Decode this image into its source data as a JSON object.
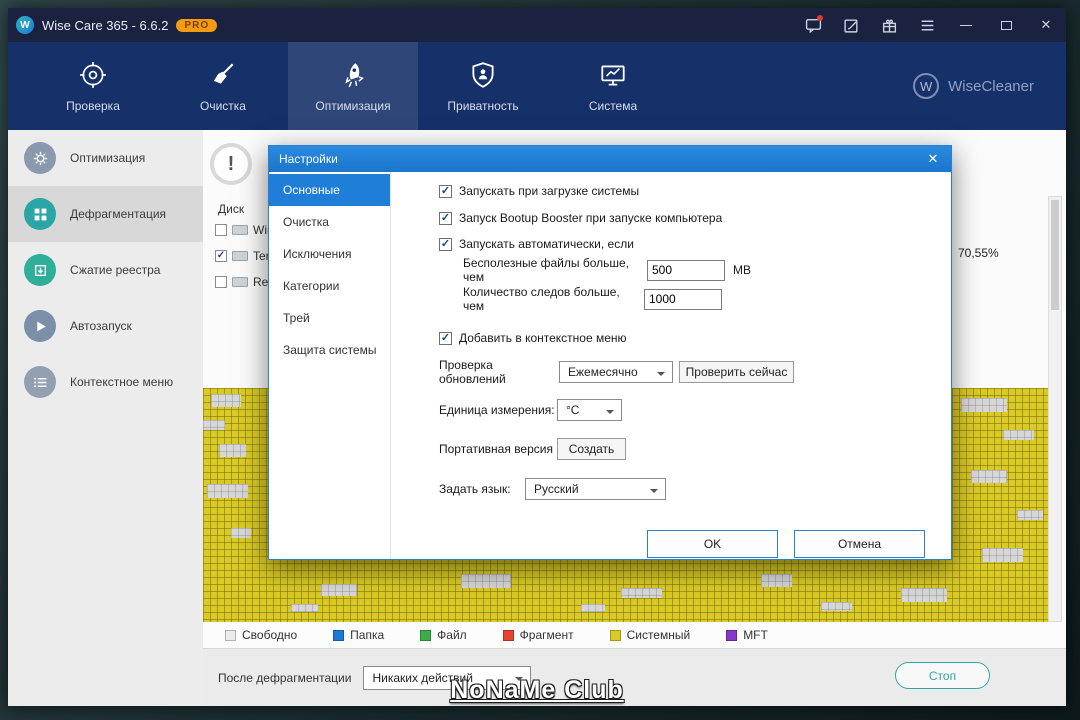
{
  "titlebar": {
    "title": "Wise Care 365 - 6.6.2",
    "pro": "PRO"
  },
  "nav": {
    "items": [
      {
        "label": "Проверка"
      },
      {
        "label": "Очистка"
      },
      {
        "label": "Оптимизация"
      },
      {
        "label": "Приватность"
      },
      {
        "label": "Система"
      }
    ],
    "brand": "WiseCleaner",
    "brand_initial": "W"
  },
  "sidebar": {
    "items": [
      {
        "label": "Оптимизация"
      },
      {
        "label": "Дефрагментация"
      },
      {
        "label": "Сжатие реестра"
      },
      {
        "label": "Автозапуск"
      },
      {
        "label": "Контекстное меню"
      }
    ]
  },
  "defrag": {
    "alert_glyph": "!",
    "disk_header": "Диск",
    "disks": [
      {
        "label": "Window",
        "checked": false
      },
      {
        "label": "Termina",
        "checked": true
      },
      {
        "label": "Replace",
        "checked": false
      }
    ],
    "usage_percent": "70,55%",
    "legend": [
      {
        "label": "Свободно",
        "color": "#ececec"
      },
      {
        "label": "Папка",
        "color": "#1d79d4"
      },
      {
        "label": "Файл",
        "color": "#3cae47"
      },
      {
        "label": "Фрагмент",
        "color": "#e54430"
      },
      {
        "label": "Системный",
        "color": "#d9ca25"
      },
      {
        "label": "MFT",
        "color": "#8636c9"
      }
    ],
    "after_label": "После дефрагментации",
    "after_value": "Никаких действий",
    "stop": "Стоп"
  },
  "settings": {
    "title": "Настройки",
    "close_glyph": "✕",
    "tabs": [
      {
        "label": "Основные"
      },
      {
        "label": "Очистка"
      },
      {
        "label": "Исключения"
      },
      {
        "label": "Категории"
      },
      {
        "label": "Трей"
      },
      {
        "label": "Защита системы"
      }
    ],
    "options": {
      "run_at_boot": "Запускать при загрузке системы",
      "bootup_booster": "Запуск Bootup Booster при запуске компьютера",
      "auto_run": "Запускать автоматически, если",
      "useless_files": "Бесполезные файлы больше, чем",
      "useless_files_value": "500",
      "useless_files_unit": "MB",
      "traces": "Количество следов больше, чем",
      "traces_value": "1000",
      "context_menu": "Добавить в контекстное меню",
      "updates_label": "Проверка обновлений",
      "updates_value": "Ежемесячно",
      "check_now": "Проверить сейчас",
      "unit_label": "Единица измерения:",
      "unit_value": "°C",
      "portable_label": "Портативная версия",
      "portable_button": "Создать",
      "language_label": "Задать язык:",
      "language_value": "Русский"
    },
    "ok": "OK",
    "cancel": "Отмена"
  },
  "watermark": "NoNaMe Club",
  "colors": {
    "accent_blue": "#1f7fd8",
    "titlebar": "#1a2240",
    "navbar": "#163069",
    "pro_badge": "#f39c12",
    "map_yellow": "#d9ca25",
    "stop_teal": "#2fa7a2"
  }
}
